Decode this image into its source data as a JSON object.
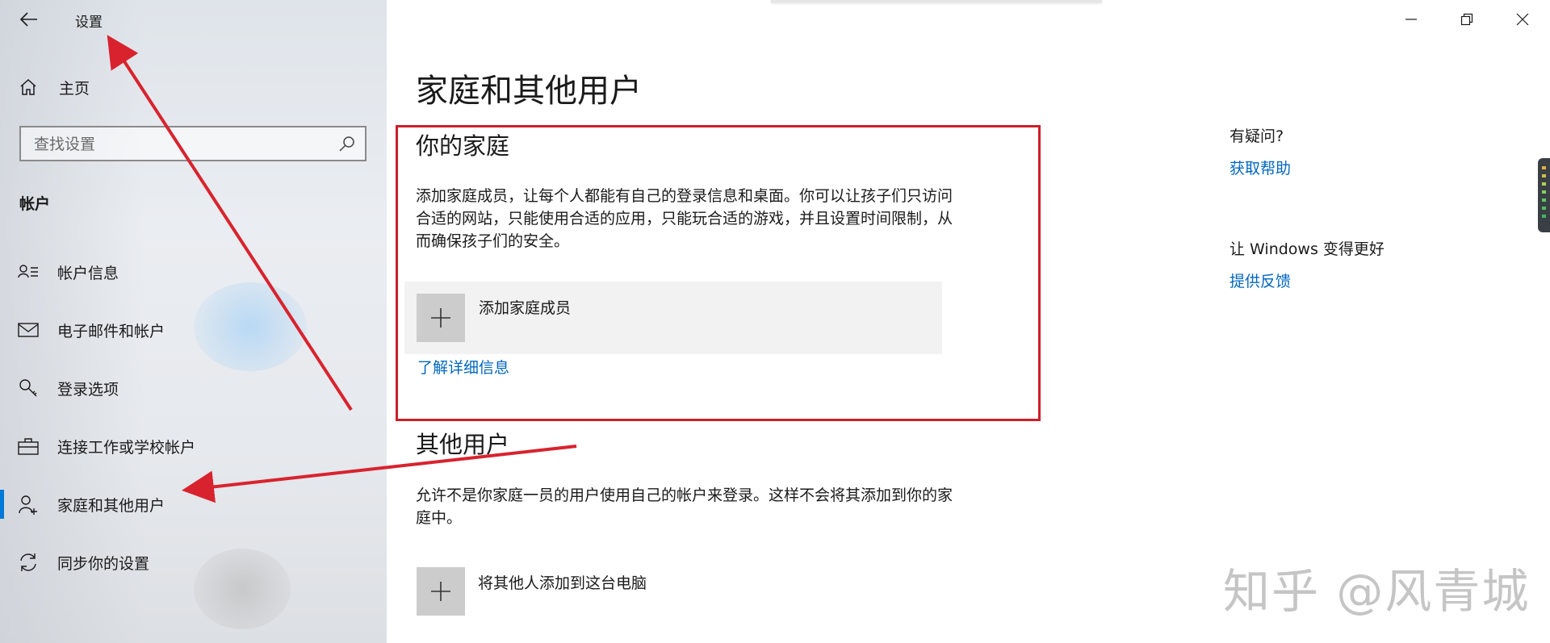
{
  "window": {
    "title": "设置",
    "controls": [
      "minimize",
      "restore",
      "close"
    ]
  },
  "sidebar": {
    "home_label": "主页",
    "search": {
      "placeholder": "查找设置",
      "value": ""
    },
    "section_title": "帐户",
    "items": [
      {
        "label": "帐户信息",
        "icon": "account-info-icon",
        "active": false
      },
      {
        "label": "电子邮件和帐户",
        "icon": "mail-icon",
        "active": false
      },
      {
        "label": "登录选项",
        "icon": "key-icon",
        "active": false
      },
      {
        "label": "连接工作或学校帐户",
        "icon": "briefcase-icon",
        "active": false
      },
      {
        "label": "家庭和其他用户",
        "icon": "add-person-icon",
        "active": true
      },
      {
        "label": "同步你的设置",
        "icon": "sync-icon",
        "active": false
      }
    ]
  },
  "main": {
    "page_title": "家庭和其他用户",
    "family": {
      "heading": "你的家庭",
      "description": "添加家庭成员，让每个人都能有自己的登录信息和桌面。你可以让孩子们只访问合适的网站，只能使用合适的应用，只能玩合适的游戏，并且设置时间限制，从而确保孩子们的安全。",
      "add_label": "添加家庭成员",
      "learn_more": "了解详细信息"
    },
    "others": {
      "heading": "其他用户",
      "description": "允许不是你家庭一员的用户使用自己的帐户来登录。这样不会将其添加到你的家庭中。",
      "add_label": "将其他人添加到这台电脑"
    }
  },
  "aside": {
    "question_title": "有疑问?",
    "help_link": "获取帮助",
    "improve_title": "让 Windows 变得更好",
    "feedback_link": "提供反馈"
  },
  "watermark": "知乎 @风青城",
  "colors": {
    "accent": "#0078d7",
    "link": "#0067c0",
    "annotation_red": "#d8232e"
  }
}
